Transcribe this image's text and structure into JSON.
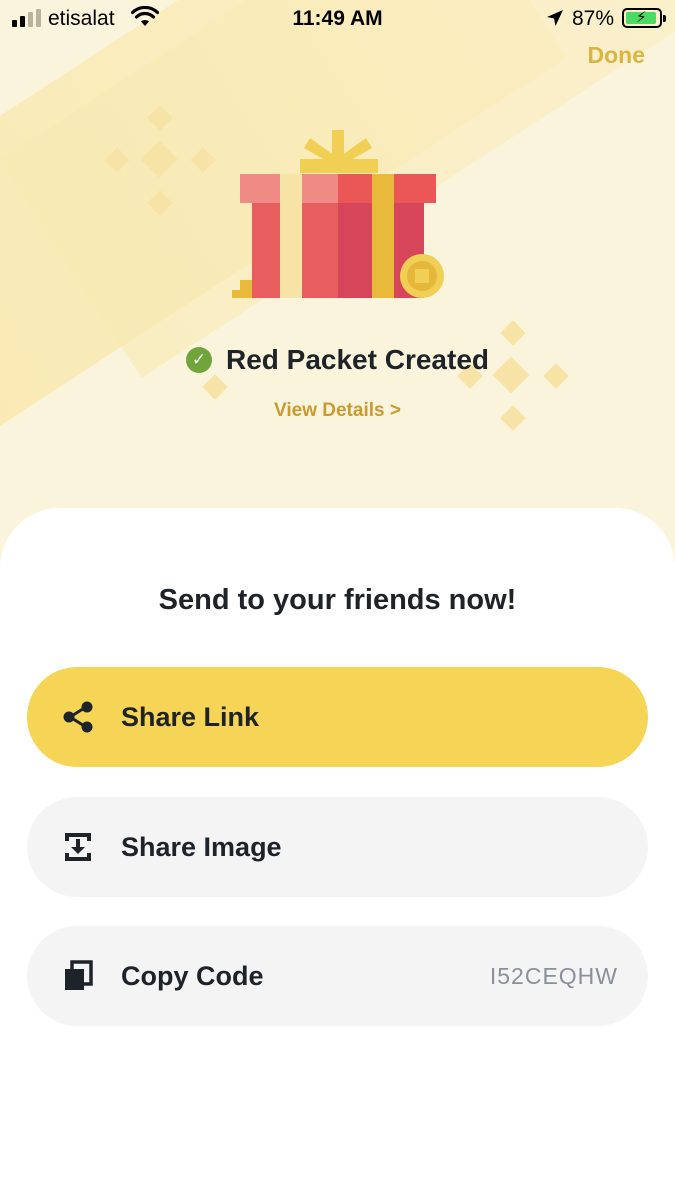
{
  "status_bar": {
    "carrier": "etisalat",
    "time": "11:49 AM",
    "battery_percent": "87%"
  },
  "header": {
    "done_label": "Done"
  },
  "result": {
    "title": "Red Packet Created",
    "view_details": "View Details >"
  },
  "share": {
    "title": "Send to your friends now!",
    "share_link_label": "Share Link",
    "share_image_label": "Share Image",
    "copy_code_label": "Copy Code",
    "code": "I52CEQHW"
  },
  "colors": {
    "accent_yellow": "#f5d456",
    "gold_text": "#d9b542",
    "success_green": "#6fa53a"
  },
  "icons": [
    "wifi-icon",
    "location-arrow-icon",
    "battery-icon",
    "gift-icon",
    "check-icon",
    "share-icon",
    "download-icon",
    "copy-icon"
  ]
}
